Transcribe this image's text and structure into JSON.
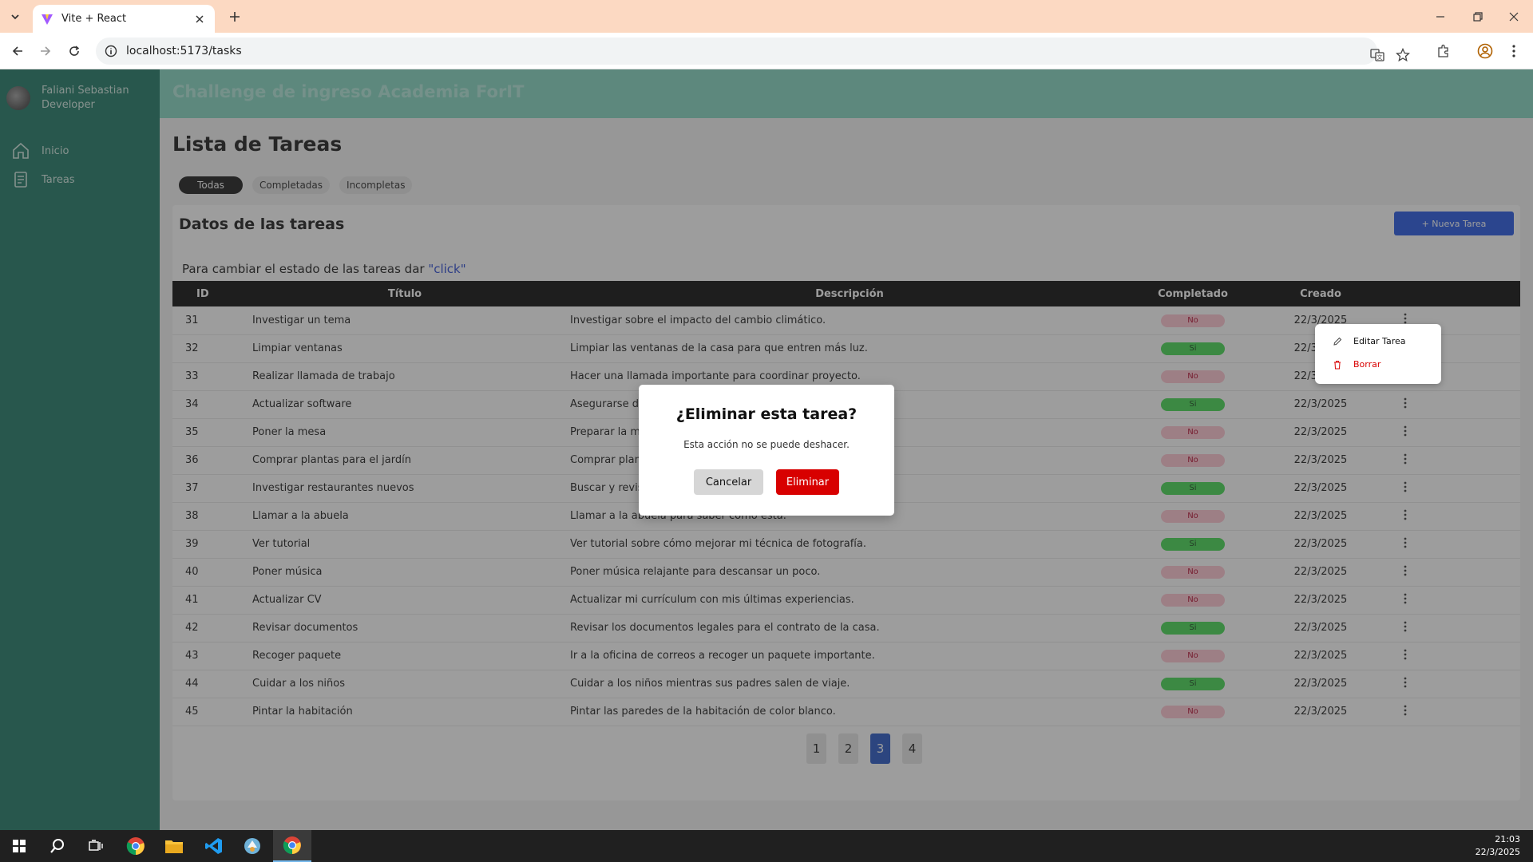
{
  "browser": {
    "tab_title": "Vite + React",
    "url": "localhost:5173/tasks"
  },
  "sidebar": {
    "user_name": "Faliani Sebastian",
    "user_role": "Developer",
    "items": [
      {
        "label": "Inicio",
        "icon": "home-icon"
      },
      {
        "label": "Tareas",
        "icon": "clipboard-icon"
      }
    ]
  },
  "header": {
    "title": "Challenge de ingreso Academia ForIT"
  },
  "main": {
    "page_title": "Lista de Tareas",
    "filters": [
      "Todas",
      "Completadas",
      "Incompletas"
    ],
    "active_filter": "Todas",
    "card_title": "Datos de las tareas",
    "new_task_label": "+ Nueva Tarea",
    "hint_text": "Para cambiar el estado de las tareas dar ",
    "hint_click": "\"click\"",
    "columns": [
      "ID",
      "Título",
      "Descripción",
      "Completado",
      "Creado"
    ],
    "rows": [
      {
        "id": "31",
        "title": "Investigar un tema",
        "desc": "Investigar sobre el impacto del cambio climático.",
        "done": "No",
        "date": "22/3/2025"
      },
      {
        "id": "32",
        "title": "Limpiar ventanas",
        "desc": "Limpiar las ventanas de la casa para que entren más luz.",
        "done": "Si",
        "date": "22/3/2025"
      },
      {
        "id": "33",
        "title": "Realizar llamada de trabajo",
        "desc": "Hacer una llamada importante para coordinar proyecto.",
        "done": "No",
        "date": "22/3/2025"
      },
      {
        "id": "34",
        "title": "Actualizar software",
        "desc": "Asegurarse de",
        "done": "Si",
        "date": "22/3/2025"
      },
      {
        "id": "35",
        "title": "Poner la mesa",
        "desc": "Preparar la m",
        "done": "No",
        "date": "22/3/2025"
      },
      {
        "id": "36",
        "title": "Comprar plantas para el jardín",
        "desc": "Comprar plan",
        "done": "No",
        "date": "22/3/2025"
      },
      {
        "id": "37",
        "title": "Investigar restaurantes nuevos",
        "desc": "Buscar y revis",
        "done": "Si",
        "date": "22/3/2025"
      },
      {
        "id": "38",
        "title": "Llamar a la abuela",
        "desc": "Llamar a la abuela para saber cómo está.",
        "done": "No",
        "date": "22/3/2025"
      },
      {
        "id": "39",
        "title": "Ver tutorial",
        "desc": "Ver tutorial sobre cómo mejorar mi técnica de fotografía.",
        "done": "Si",
        "date": "22/3/2025"
      },
      {
        "id": "40",
        "title": "Poner música",
        "desc": "Poner música relajante para descansar un poco.",
        "done": "No",
        "date": "22/3/2025"
      },
      {
        "id": "41",
        "title": "Actualizar CV",
        "desc": "Actualizar mi currículum con mis últimas experiencias.",
        "done": "No",
        "date": "22/3/2025"
      },
      {
        "id": "42",
        "title": "Revisar documentos",
        "desc": "Revisar los documentos legales para el contrato de la casa.",
        "done": "Si",
        "date": "22/3/2025"
      },
      {
        "id": "43",
        "title": "Recoger paquete",
        "desc": "Ir a la oficina de correos a recoger un paquete importante.",
        "done": "No",
        "date": "22/3/2025"
      },
      {
        "id": "44",
        "title": "Cuidar a los niños",
        "desc": "Cuidar a los niños mientras sus padres salen de viaje.",
        "done": "Si",
        "date": "22/3/2025"
      },
      {
        "id": "45",
        "title": "Pintar la habitación",
        "desc": "Pintar las paredes de la habitación de color blanco.",
        "done": "No",
        "date": "22/3/2025"
      }
    ],
    "pages": [
      "1",
      "2",
      "3",
      "4"
    ],
    "current_page": "3"
  },
  "context_menu": {
    "edit_label": "Editar Tarea",
    "delete_label": "Borrar"
  },
  "modal": {
    "title": "¿Eliminar esta tarea?",
    "text": "Esta acción no se puede deshacer.",
    "cancel_label": "Cancelar",
    "delete_label": "Eliminar"
  },
  "taskbar": {
    "time": "21:03",
    "date": "22/3/2025"
  },
  "colors": {
    "sidebar": "#14735f",
    "header": "#7fd4bf",
    "primary_button": "#1b4fe0",
    "danger": "#d80000",
    "badge_si": "#3cd64a",
    "badge_no": "#ffc2cf"
  }
}
